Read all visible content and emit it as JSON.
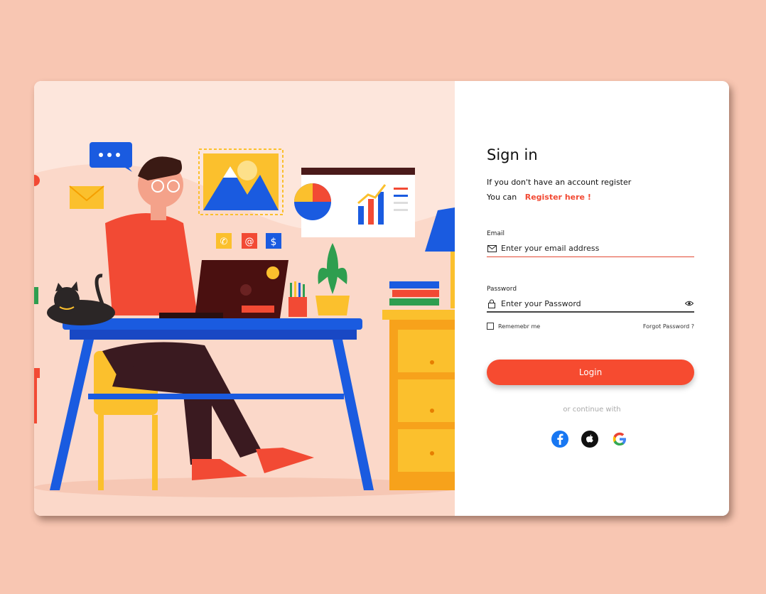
{
  "signin": {
    "title": "Sign in",
    "subtitle": "If you don't have an account register",
    "you_can": "You can",
    "register_link": "Register here !",
    "email_label": "Email",
    "email_placeholder": "Enter your email address",
    "password_label": "Password",
    "password_placeholder": "Enter your Password",
    "remember": "Rememebr me",
    "forgot": "Forgot Password ?",
    "login": "Login",
    "continue_with": "or continue with"
  },
  "socials": [
    "facebook-icon",
    "apple-icon",
    "google-icon"
  ],
  "colors": {
    "background": "#f8c6b2",
    "accent": "#f64b30",
    "illustration_bg": "#fde6dc",
    "desk_blue": "#1a5be0"
  }
}
